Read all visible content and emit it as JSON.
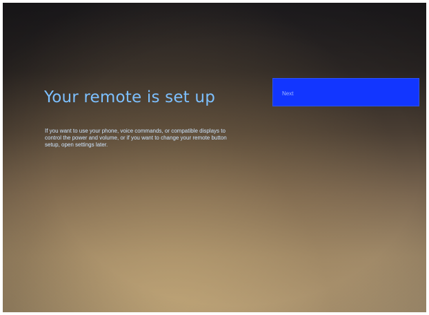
{
  "setup": {
    "title": "Your remote is set up",
    "description": "If you want to use your phone, voice commands, or compatible displays to control the power and volume, or if you want to change your remote button setup, open settings later.",
    "next_label": "Next"
  },
  "colors": {
    "title_text": "#7dc0ff",
    "button_bg": "#1236ff"
  }
}
